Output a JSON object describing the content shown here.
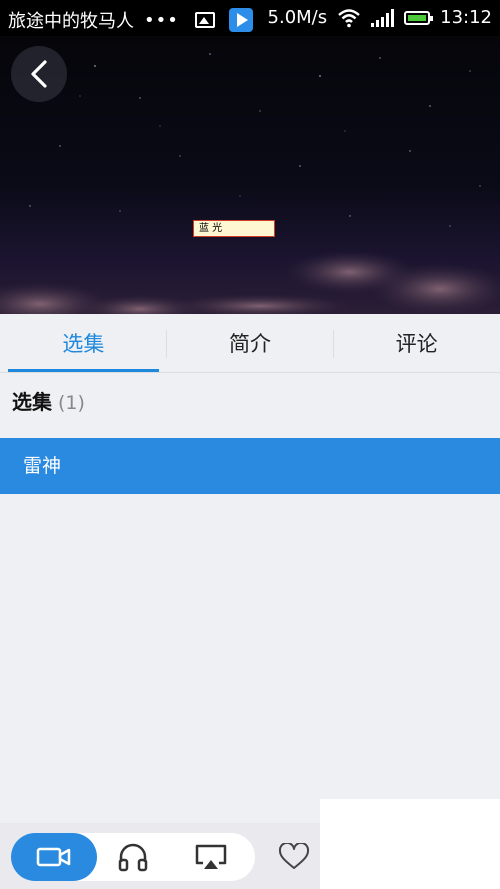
{
  "status_bar": {
    "notification_title": "旅途中的牧马人",
    "more_dots": "•••",
    "speed": "5.0M/s",
    "time": "13:12",
    "icons": [
      "gallery-icon",
      "play-store-icon",
      "wifi-icon",
      "signal-icon",
      "battery-icon"
    ]
  },
  "player": {
    "back_icon": "back-arrow-icon",
    "subtitle_box_text": "蓝 光"
  },
  "tabs": [
    {
      "label": "选集",
      "active": true
    },
    {
      "label": "简介",
      "active": false
    },
    {
      "label": "评论",
      "active": false
    }
  ],
  "episodes": {
    "heading": "选集",
    "count": "(1)",
    "items": [
      {
        "label": "雷神",
        "selected": true
      }
    ]
  },
  "bottom_bar": {
    "modes": [
      "video-icon",
      "headphones-icon",
      "airplay-icon"
    ],
    "active_mode": "video-icon",
    "favorite_icon": "heart-icon"
  },
  "colors": {
    "accent": "#1e88dc",
    "selected_row": "#2a8ae0",
    "background": "#eff0f3"
  }
}
